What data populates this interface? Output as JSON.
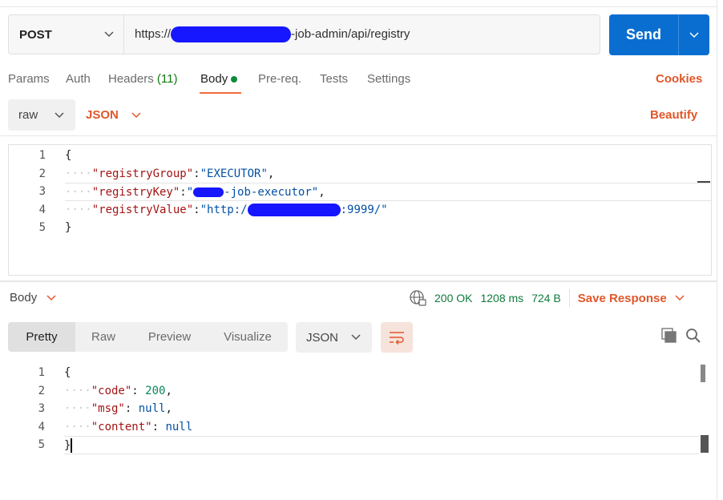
{
  "request": {
    "method": "POST",
    "url_prefix": "https://",
    "url_suffix": "-job-admin/api/registry",
    "send_label": "Send"
  },
  "tabs": [
    {
      "label": "Params"
    },
    {
      "label": "Auth"
    },
    {
      "label": "Headers",
      "count": "(11)"
    },
    {
      "label": "Body"
    },
    {
      "label": "Pre-req."
    },
    {
      "label": "Tests"
    },
    {
      "label": "Settings"
    }
  ],
  "cookies_label": "Cookies",
  "body_options": {
    "mode": "raw",
    "language": "JSON",
    "beautify_label": "Beautify"
  },
  "request_body": {
    "line_numbers": [
      "1",
      "2",
      "3",
      "4",
      "5"
    ],
    "open_brace": "{",
    "close_brace": "}",
    "keys": [
      "\"registryGroup\"",
      "\"registryKey\"",
      "\"registryValue\""
    ],
    "values": [
      "\"EXECUTOR\"",
      "-job-executor\"",
      ":9999/\""
    ],
    "value_prefixes": [
      "",
      "\"",
      "\"http:/"
    ]
  },
  "response": {
    "section_label": "Body",
    "status": "200 OK",
    "time": "1208 ms",
    "size": "724 B",
    "save_label": "Save Response",
    "view_tabs": [
      {
        "label": "Pretty"
      },
      {
        "label": "Raw"
      },
      {
        "label": "Preview"
      },
      {
        "label": "Visualize"
      }
    ],
    "format": "JSON",
    "line_numbers": [
      "1",
      "2",
      "3",
      "4",
      "5"
    ],
    "open_brace": "{",
    "close_brace": "}",
    "keys": [
      "\"code\"",
      "\"msg\"",
      "\"content\""
    ],
    "values": [
      "200",
      "null",
      "null"
    ]
  },
  "colors": {
    "accent": "#e0572a",
    "send_button": "#0a6ed1",
    "status_ok": "#0f7b3c"
  }
}
